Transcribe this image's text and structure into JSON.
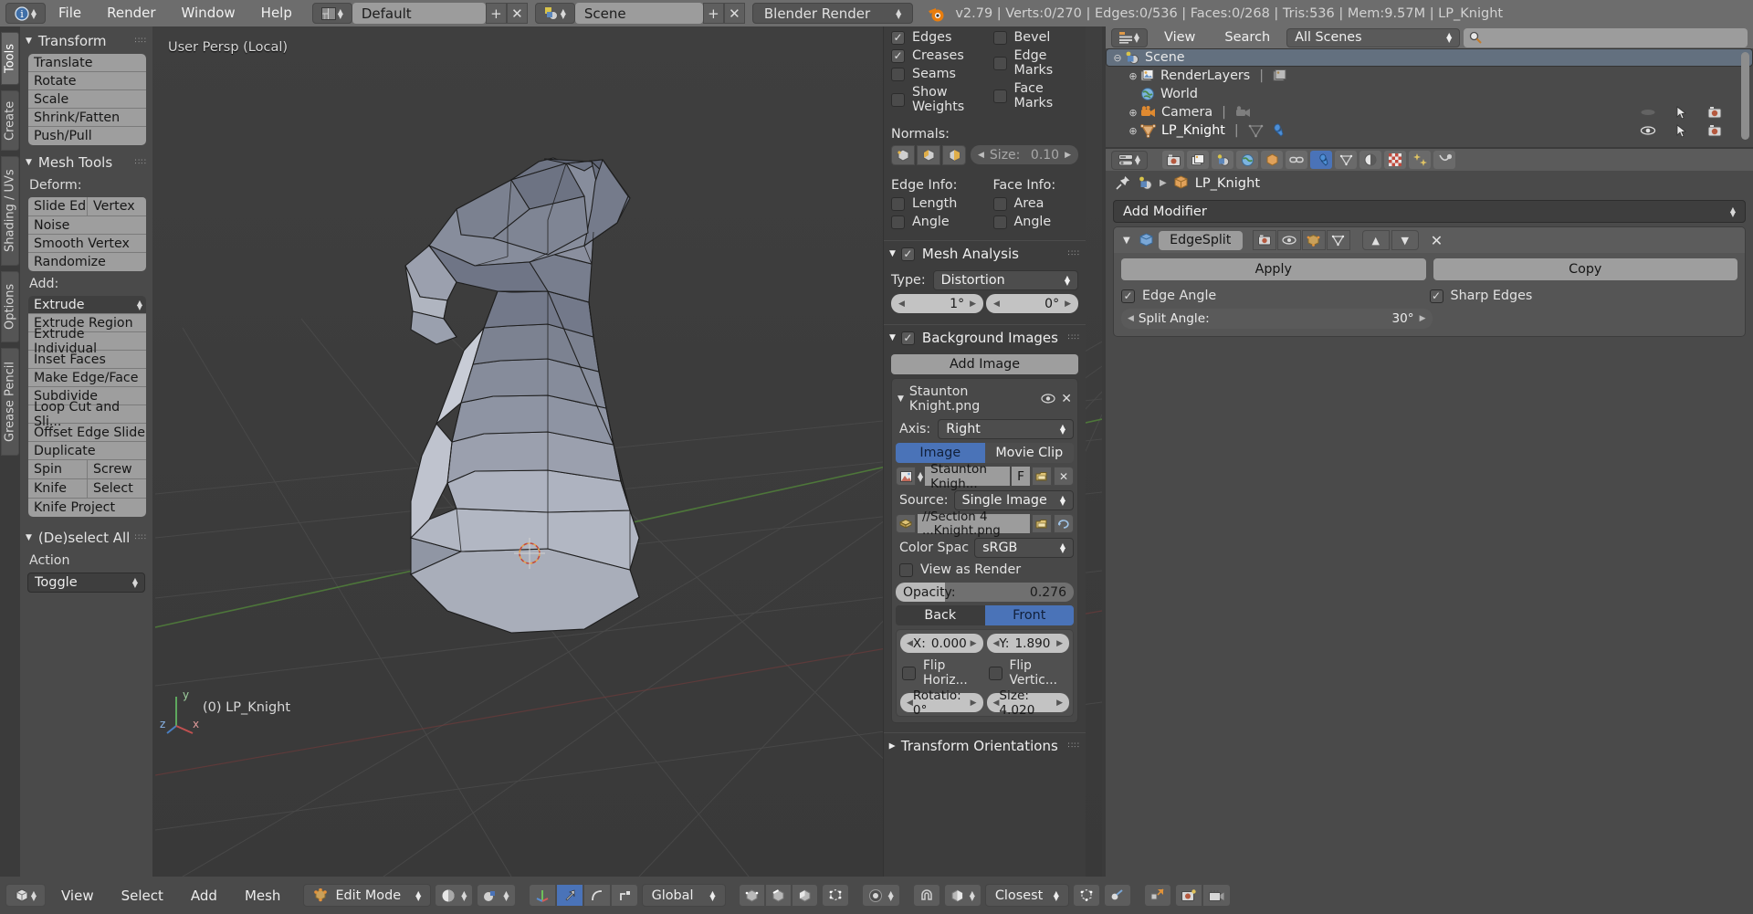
{
  "topbar": {
    "editor_icon": "info-editor-icon",
    "menus": [
      "File",
      "Render",
      "Window",
      "Help"
    ],
    "layout_icon": "screen-layout-icon",
    "layout_value": "Default",
    "add_label": "+",
    "remove_label": "✕",
    "scene_icon": "scene-icon",
    "scene_value": "Scene",
    "engine_value": "Blender Render",
    "blender_icon": "blender-logo-icon",
    "status": "v2.79 | Verts:0/270 | Edges:0/536 | Faces:0/268 | Tris:536 | Mem:9.57M | LP_Knight"
  },
  "viewport": {
    "header_text": "User Persp (Local)",
    "footer_text": "(0) LP_Knight",
    "axis_x": "x",
    "axis_y": "y",
    "axis_z": "z"
  },
  "tabs": [
    {
      "label": "Tools",
      "active": true
    },
    {
      "label": "Create",
      "active": false
    },
    {
      "label": "Shading / UVs",
      "active": false
    },
    {
      "label": "Options",
      "active": false
    },
    {
      "label": "Grease Pencil",
      "active": false
    }
  ],
  "toolpanel": {
    "transform": {
      "title": "Transform",
      "buttons": [
        "Translate",
        "Rotate",
        "Scale",
        "Shrink/Fatten",
        "Push/Pull"
      ]
    },
    "mesh_tools": {
      "title": "Mesh Tools",
      "deform_label": "Deform:",
      "deform_row": [
        "Slide Ed",
        "Vertex"
      ],
      "deform_buttons": [
        "Noise",
        "Smooth Vertex",
        "Randomize"
      ],
      "add_label": "Add:",
      "add_active": "Extrude",
      "add_buttons": [
        "Extrude Region",
        "Extrude Individual",
        "Inset Faces",
        "Make Edge/Face",
        "Subdivide",
        "Loop Cut and Sli...",
        "Offset Edge Slide",
        "Duplicate"
      ],
      "add_row1": [
        "Spin",
        "Screw"
      ],
      "add_row2": [
        "Knife",
        "Select"
      ],
      "add_last": "Knife Project"
    },
    "deselect": {
      "title": "(De)select All",
      "action_label": "Action",
      "action_value": "Toggle"
    }
  },
  "npanel": {
    "overlays": {
      "col1": [
        {
          "label": "Edges",
          "checked": true
        },
        {
          "label": "Creases",
          "checked": true
        },
        {
          "label": "Seams",
          "checked": false
        },
        {
          "label": "Show Weights",
          "checked": false
        }
      ],
      "col2": [
        {
          "label": "Bevel",
          "checked": false
        },
        {
          "label": "Edge Marks",
          "checked": false
        },
        {
          "label": "Face Marks",
          "checked": false
        }
      ],
      "normals_label": "Normals:",
      "size_label": "Size:",
      "size_value": "0.10",
      "edge_info_label": "Edge Info:",
      "face_info_label": "Face Info:",
      "edge_info": [
        {
          "label": "Length",
          "checked": false
        },
        {
          "label": "Angle",
          "checked": false
        }
      ],
      "face_info": [
        {
          "label": "Area",
          "checked": false
        },
        {
          "label": "Angle",
          "checked": false
        }
      ]
    },
    "mesh_analysis": {
      "title": "Mesh Analysis",
      "enabled": true,
      "type_label": "Type:",
      "type_value": "Distortion",
      "min_value": "1°",
      "max_value": "0°"
    },
    "background_images": {
      "title": "Background Images",
      "enabled": true,
      "add_image": "Add Image",
      "image_name": "Staunton Knight.png",
      "axis_label": "Axis:",
      "axis_value": "Right",
      "source_tabs": [
        "Image",
        "Movie Clip"
      ],
      "source_tab_active": "Image",
      "datablock_name": "Staunton Knigh...",
      "fake_user": "F",
      "source_label": "Source:",
      "source_value": "Single Image",
      "filepath": "//Section 4 ...Knight.png",
      "colorspace_label": "Color Spac",
      "colorspace_value": "sRGB",
      "view_as_render": "View as Render",
      "opacity_label": "Opacity:",
      "opacity_value": "0.276",
      "depth_tabs": [
        "Back",
        "Front"
      ],
      "depth_active": "Front",
      "x_label": "X:",
      "x_value": "0.000",
      "y_label": "Y:",
      "y_value": "1.890",
      "flip_h": "Flip Horiz...",
      "flip_v": "Flip Vertic...",
      "rotation": "Rotatio: 0°",
      "size": "Size: 4.020"
    },
    "transform_orientations": {
      "title": "Transform Orientations"
    }
  },
  "outliner": {
    "editor_icon": "outliner-editor-icon",
    "menus": [
      "View",
      "Search"
    ],
    "display_mode": "All Scenes",
    "search_placeholder": "",
    "search_icon": "search-icon",
    "rows": [
      {
        "label": "Scene",
        "icon": "scene-icon",
        "indent": 0,
        "selected": true,
        "expander": "⊖"
      },
      {
        "label": "RenderLayers",
        "icon": "renderlayers-icon",
        "indent": 1,
        "selected": false,
        "expander": "⊕"
      },
      {
        "label": "World",
        "icon": "world-icon",
        "indent": 1,
        "selected": false,
        "expander": ""
      },
      {
        "label": "Camera",
        "icon": "camera-icon",
        "indent": 1,
        "selected": false,
        "expander": "⊕"
      },
      {
        "label": "LP_Knight",
        "icon": "mesh-object-icon",
        "indent": 1,
        "selected": false,
        "expander": "⊕"
      }
    ]
  },
  "properties": {
    "tabs": [
      {
        "name": "render-tab",
        "glyph": "📷",
        "active": false
      },
      {
        "name": "renderlayers-tab",
        "glyph": "🖼",
        "active": false
      },
      {
        "name": "scene-tab",
        "glyph": "◑",
        "active": false
      },
      {
        "name": "world-tab",
        "glyph": "🌐",
        "active": false
      },
      {
        "name": "object-tab",
        "glyph": "⬛",
        "active": false
      },
      {
        "name": "constraints-tab",
        "glyph": "🔗",
        "active": false
      },
      {
        "name": "modifiers-tab",
        "glyph": "🔧",
        "active": true
      },
      {
        "name": "data-tab",
        "glyph": "▽",
        "active": false
      },
      {
        "name": "material-tab",
        "glyph": "◐",
        "active": false
      },
      {
        "name": "texture-tab",
        "glyph": "▒",
        "active": false
      },
      {
        "name": "particles-tab",
        "glyph": "❇",
        "active": false
      },
      {
        "name": "physics-tab",
        "glyph": "●",
        "active": false
      }
    ],
    "breadcrumb_pin": "pin-icon",
    "breadcrumb_scene": "scene-icon",
    "breadcrumb_object": "LP_Knight",
    "add_modifier": "Add Modifier",
    "modifier": {
      "name": "EdgeSplit",
      "icon": "edgesplit-icon",
      "apply": "Apply",
      "copy": "Copy",
      "edge_angle_label": "Edge Angle",
      "edge_angle_checked": true,
      "sharp_edges_label": "Sharp Edges",
      "sharp_edges_checked": true,
      "split_angle_label": "Split Angle:",
      "split_angle_value": "30°"
    }
  },
  "bottombar": {
    "editor_icon": "3dview-editor-icon",
    "menus": [
      "View",
      "Select",
      "Add",
      "Mesh"
    ],
    "mode_icon": "edit-mode-icon",
    "mode_value": "Edit Mode",
    "shading_icon": "solid-shading-icon",
    "select_modes": [
      "vertex-select-icon",
      "edge-select-icon",
      "face-select-icon"
    ],
    "pivot_icon": "pivot-median-icon",
    "manipulator_icons": [
      "translate-manipulator-icon",
      "rotate-manipulator-icon",
      "scale-manipulator-icon"
    ],
    "orientation_value": "Global",
    "limit_icons": [
      "limit-to-visible-icon",
      "xray-icon",
      "occlude-icon"
    ],
    "proportional_icon": "proportional-edit-icon",
    "falloff_icon": "falloff-icon",
    "snap_icon": "snap-magnet-icon",
    "snap_element_icon": "snap-element-icon",
    "snap_target_value": "Closest",
    "extra_icons": [
      "snap-target-icon",
      "auto-merge-icon",
      "render-icon",
      "render-anim-icon"
    ]
  },
  "colors": {
    "accent_blue": "#4a73b8",
    "panel_bg": "#4a4a4a",
    "viewport_bg": "#3d3d3d",
    "header_bg": "#6d6d6d",
    "button_light": "#9e9e9e"
  }
}
